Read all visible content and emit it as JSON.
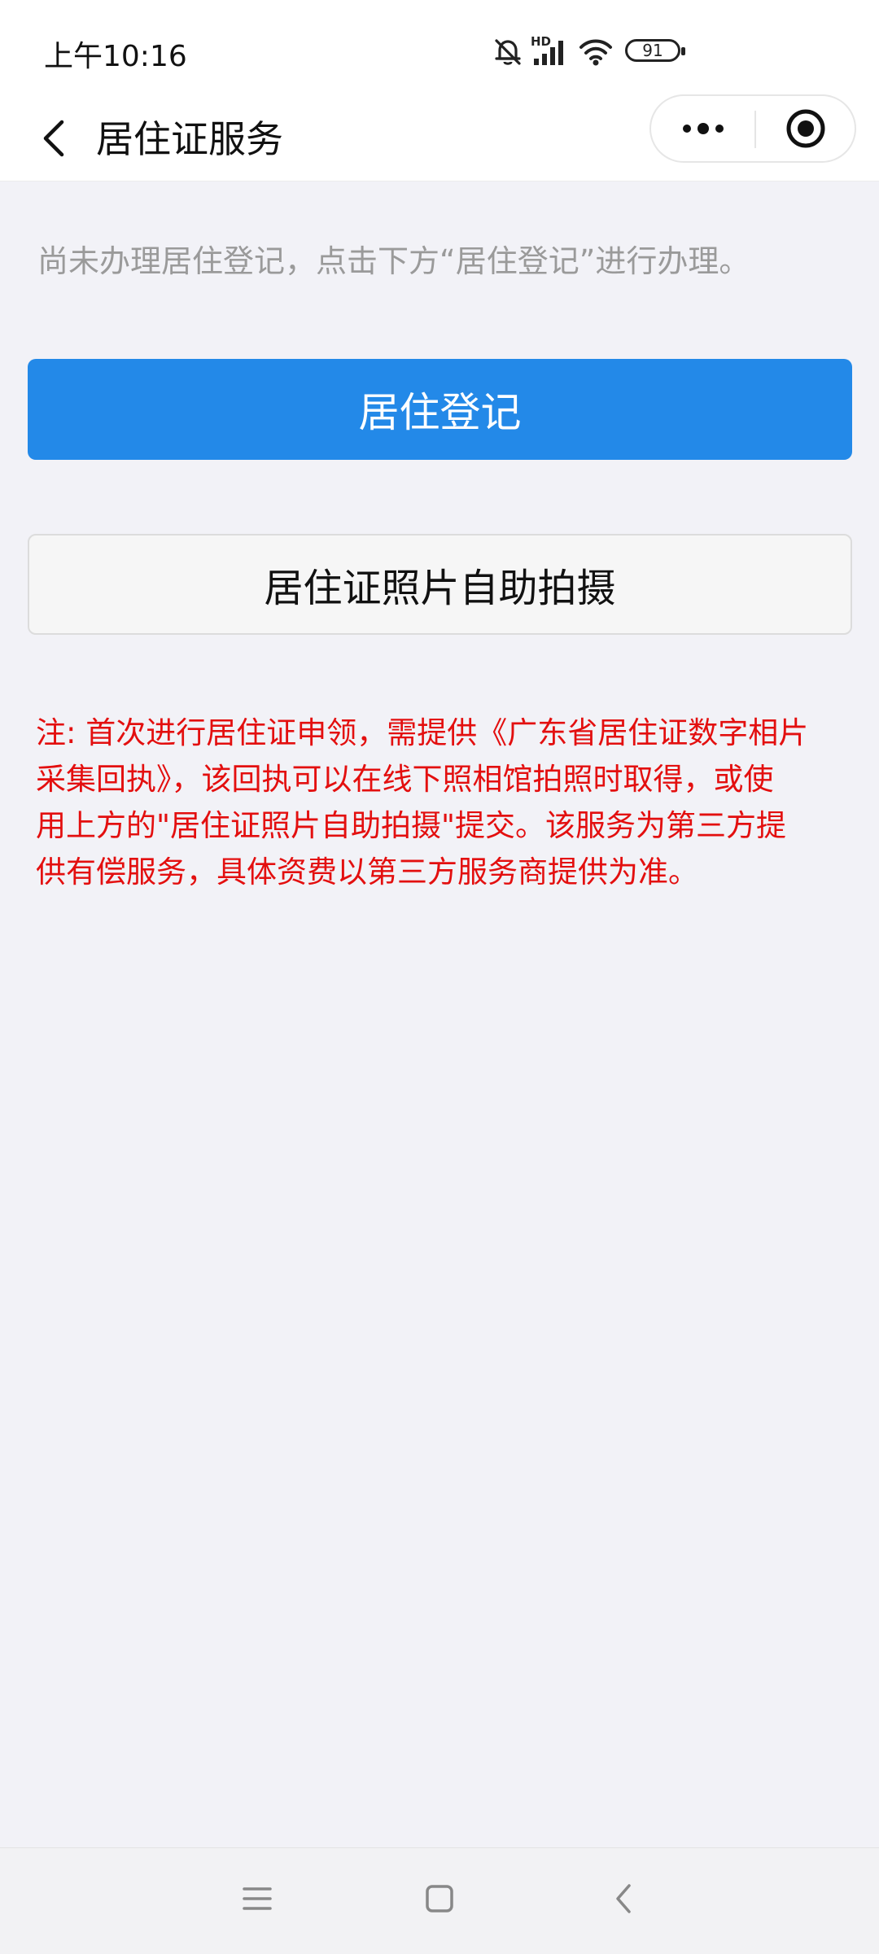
{
  "status_bar": {
    "time": "上午10:16",
    "network_label": "HD",
    "battery": "91",
    "icons": [
      "mute-bell-icon",
      "signal-icon",
      "wifi-icon",
      "battery-icon"
    ]
  },
  "nav_bar": {
    "title": "居住证服务",
    "icons": [
      "back-arrow-icon",
      "more-dots-icon",
      "close-target-icon"
    ]
  },
  "main": {
    "hint": "尚未办理居住登记，点击下方“居住登记”进行办理。",
    "primary_button": "居住登记",
    "secondary_button": "居住证照片自助拍摄",
    "note_lines": [
      "注: 首次进行居住证申领，需提供《广东省居住证数字相片",
      "采集回执》，该回执可以在线下照相馆拍照时取得，或使",
      "用上方的\"居住证照片自助拍摄\"提交。该服务为第三方提",
      "供有偿服务，具体资费以第三方服务商提供为准。"
    ]
  },
  "bottom_nav": {
    "icons": [
      "menu-lines-icon",
      "home-square-icon",
      "back-chevron-icon"
    ]
  },
  "colors": {
    "primary_button": "#2389e8",
    "note_text": "#e30f0f",
    "background": "#f2f2f7"
  }
}
